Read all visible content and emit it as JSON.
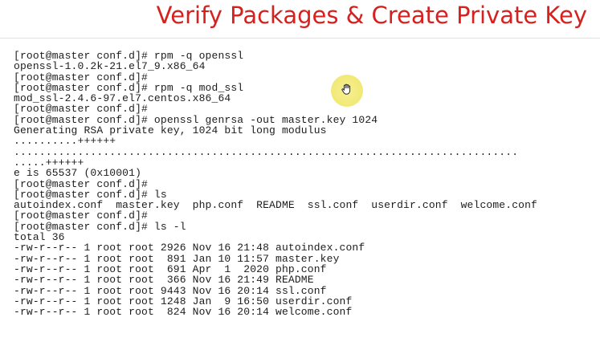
{
  "title": "Verify Packages & Create Private Key",
  "accent_color": "#d6211e",
  "cursor": {
    "icon": "hand-grab-icon"
  },
  "terminal": {
    "lines": [
      "[root@master conf.d]# rpm -q openssl",
      "openssl-1.0.2k-21.el7_9.x86_64",
      "[root@master conf.d]#",
      "[root@master conf.d]# rpm -q mod_ssl",
      "mod_ssl-2.4.6-97.el7.centos.x86_64",
      "[root@master conf.d]#",
      "[root@master conf.d]# openssl genrsa -out master.key 1024",
      "Generating RSA private key, 1024 bit long modulus",
      "..........++++++",
      "...............................................................................",
      ".....++++++",
      "e is 65537 (0x10001)",
      "[root@master conf.d]#",
      "[root@master conf.d]# ls",
      "autoindex.conf  master.key  php.conf  README  ssl.conf  userdir.conf  welcome.conf",
      "[root@master conf.d]#",
      "[root@master conf.d]# ls -l",
      "total 36",
      "-rw-r--r-- 1 root root 2926 Nov 16 21:48 autoindex.conf",
      "-rw-r--r-- 1 root root  891 Jan 10 11:57 master.key",
      "-rw-r--r-- 1 root root  691 Apr  1  2020 php.conf",
      "-rw-r--r-- 1 root root  366 Nov 16 21:49 README",
      "-rw-r--r-- 1 root root 9443 Nov 16 20:14 ssl.conf",
      "-rw-r--r-- 1 root root 1248 Jan  9 16:50 userdir.conf",
      "-rw-r--r-- 1 root root  824 Nov 16 20:14 welcome.conf"
    ]
  }
}
